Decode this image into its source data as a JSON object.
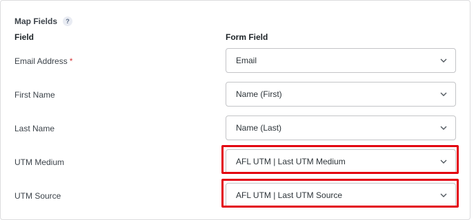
{
  "section": {
    "title": "Map Fields",
    "help_glyph": "?"
  },
  "headers": {
    "field": "Field",
    "form_field": "Form Field"
  },
  "rows": [
    {
      "label": "Email Address",
      "required_mark": "*",
      "value": "Email"
    },
    {
      "label": "First Name",
      "value": "Name (First)"
    },
    {
      "label": "Last Name",
      "value": "Name (Last)"
    },
    {
      "label": "UTM Medium",
      "value": "AFL UTM | Last UTM Medium",
      "highlighted": true
    },
    {
      "label": "UTM Source",
      "value": "AFL UTM | Last UTM Source",
      "highlighted": true
    }
  ],
  "colors": {
    "highlight": "#e3000f",
    "required": "#d63638",
    "border": "#c3c4c7"
  }
}
